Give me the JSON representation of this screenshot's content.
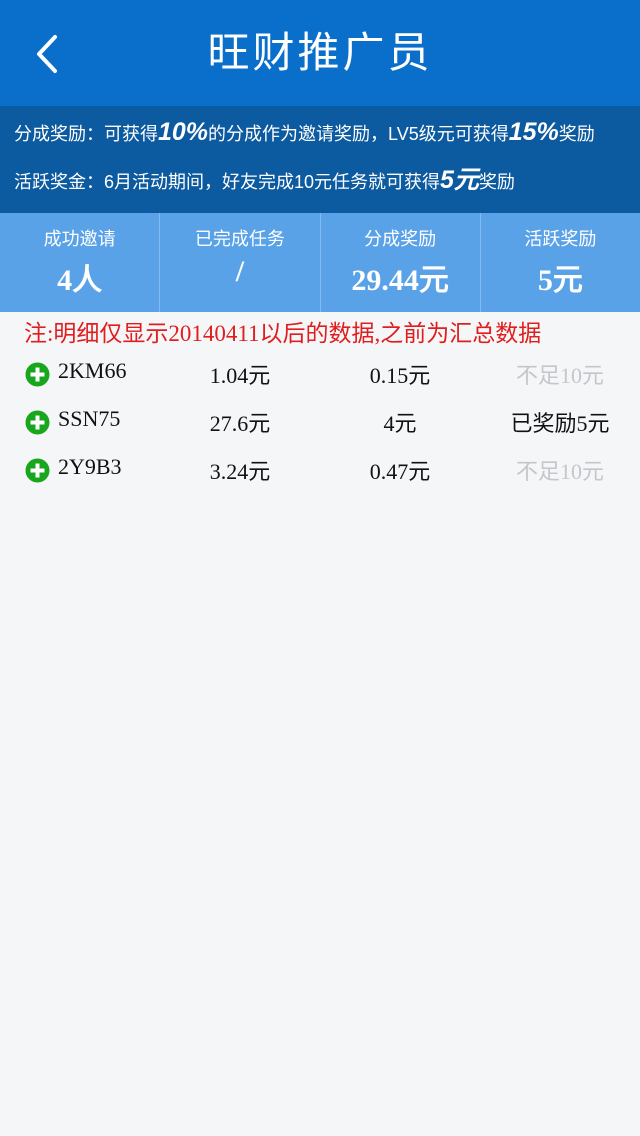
{
  "header": {
    "title": "旺财推广员",
    "back_icon": "chevron-left-icon"
  },
  "promo": {
    "line1": {
      "a": "分成奖励：可获得",
      "em1": "10%",
      "b": "的分成作为邀请奖励，LV5级元可获得",
      "em2": "15%",
      "c": "奖励"
    },
    "line2": {
      "a": "活跃奖金：6月活动期间，好友完成10元任务就可获得",
      "em1": "5元",
      "b": "奖励"
    }
  },
  "stats": [
    {
      "label": "成功邀请",
      "value": "4人"
    },
    {
      "label": "已完成任务",
      "value": "/"
    },
    {
      "label": "分成奖励",
      "value": "29.44元"
    },
    {
      "label": "活跃奖励",
      "value": "5元"
    }
  ],
  "note": "注:明细仅显示20140411以后的数据,之前为汇总数据",
  "rows": [
    {
      "code": "2KM66",
      "amount": "1.04元",
      "share": "0.15元",
      "status": "不足10元"
    },
    {
      "code": "SSN75",
      "amount": "27.6元",
      "share": "4元",
      "status": "已奖励5元"
    },
    {
      "code": "2Y9B3",
      "amount": "3.24元",
      "share": "0.47元",
      "status": "不足10元"
    }
  ],
  "colors": {
    "header_bg": "#0a6fcb",
    "promo_bg": "#0c5a9f",
    "stats_bg": "#5aa2e8",
    "note_red": "#e01e1e",
    "add_green": "#17a61c",
    "muted_gray": "#c4c6cb"
  }
}
